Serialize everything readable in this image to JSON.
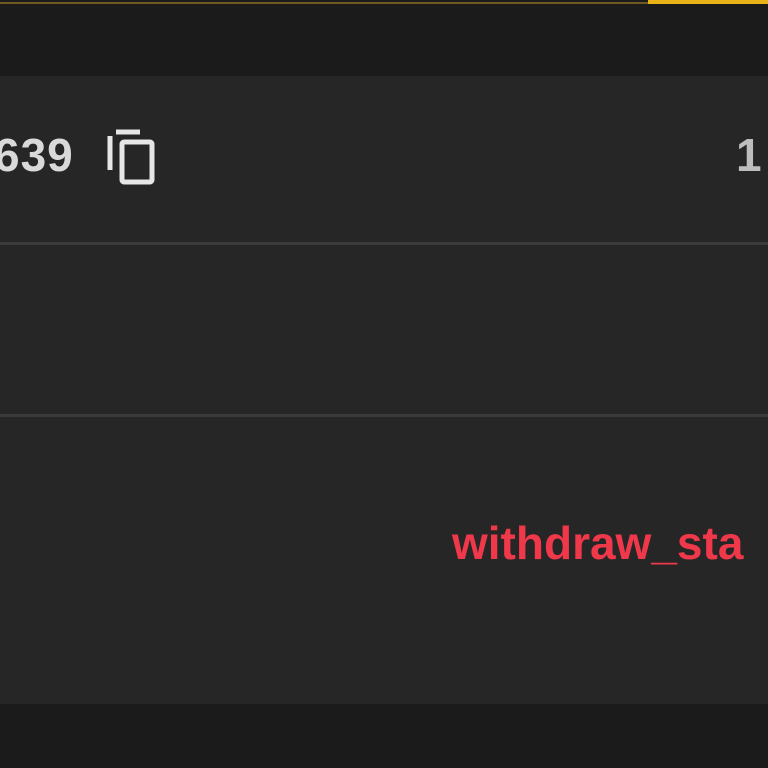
{
  "header": {
    "accent_color": "#e7b316"
  },
  "record": {
    "address_tail": "639",
    "copy_icon": "copy-icon",
    "right_value": "1",
    "status": "withdraw_sta",
    "status_color": "#f0384b"
  }
}
